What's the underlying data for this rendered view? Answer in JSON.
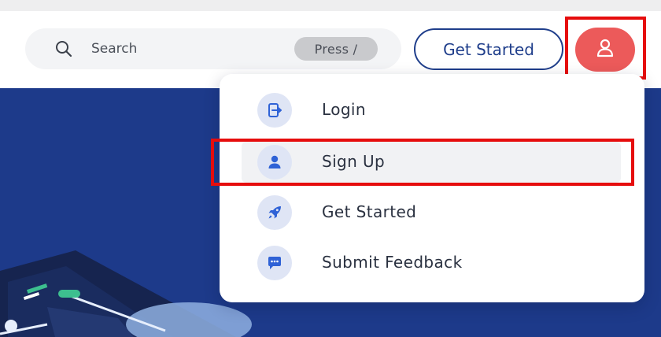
{
  "header": {
    "search": {
      "placeholder": "Search",
      "shortcut_label": "Press /"
    },
    "get_started_label": "Get Started",
    "user_icon": "user-icon"
  },
  "dropdown": {
    "items": [
      {
        "label": "Login",
        "icon": "login-icon"
      },
      {
        "label": "Sign Up",
        "icon": "user-icon",
        "highlighted": true
      },
      {
        "label": "Get Started",
        "icon": "rocket-icon"
      },
      {
        "label": "Submit Feedback",
        "icon": "chat-icon"
      }
    ]
  },
  "colors": {
    "brand_blue": "#1f3e8b",
    "hero_blue": "#1d3a8a",
    "avatar_red": "#ec5a5a",
    "highlight_red": "#e60d0d",
    "icon_bubble": "#dfe5f5",
    "icon_blue": "#2f62d6"
  }
}
